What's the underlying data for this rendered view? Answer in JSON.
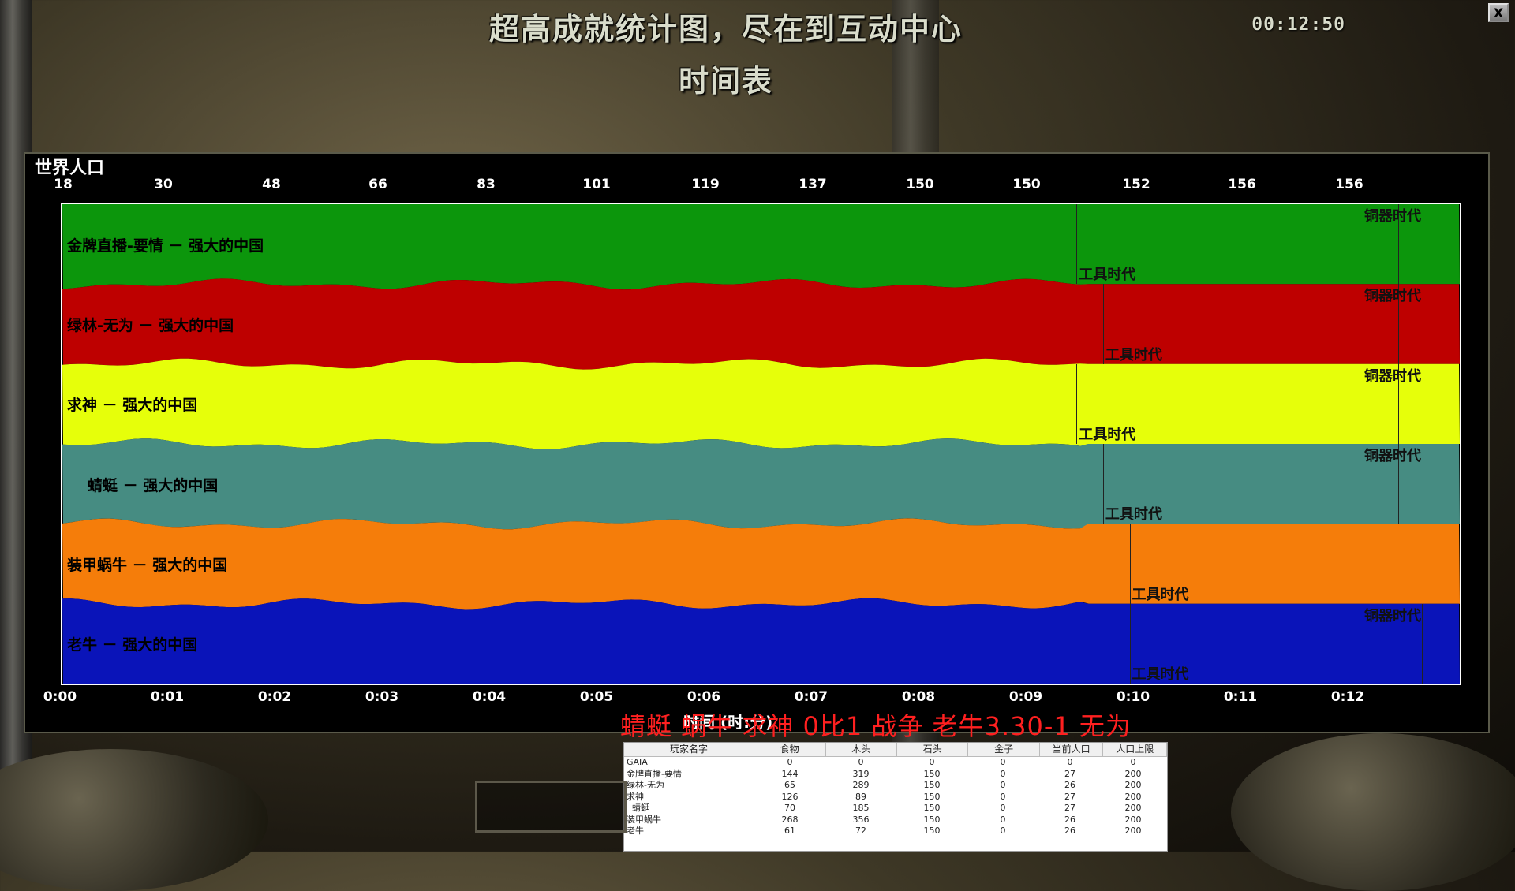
{
  "header": {
    "main_title": "超高成就统计图，尽在到互动中心",
    "sub_title": "时间表",
    "clock": "00:12:50",
    "close_label": "X"
  },
  "chart_data": {
    "type": "area",
    "label": "世界人口",
    "population_ticks": [
      "18",
      "30",
      "48",
      "66",
      "83",
      "101",
      "119",
      "137",
      "150",
      "150",
      "152",
      "156",
      "156"
    ],
    "time_ticks": [
      "0:00",
      "0:01",
      "0:02",
      "0:03",
      "0:04",
      "0:05",
      "0:06",
      "0:07",
      "0:08",
      "0:09",
      "0:10",
      "0:11",
      "0:12"
    ],
    "time_axis_label": "时间 (时:分)",
    "players": [
      {
        "name": "金牌直播-要情 － 强大的中国",
        "color": "#0c960c",
        "text_color": "#000000",
        "ages": [
          {
            "label": "工具时代",
            "time_min": 9.55
          },
          {
            "label": "铜器时代",
            "time_min": 12.58
          }
        ]
      },
      {
        "name": "绿林-无为 － 强大的中国",
        "color": "#be0000",
        "text_color": "#000000",
        "ages": [
          {
            "label": "工具时代",
            "time_min": 9.8
          },
          {
            "label": "铜器时代",
            "time_min": 12.58
          }
        ]
      },
      {
        "name": "求神 － 强大的中国",
        "color": "#e6ff0a",
        "text_color": "#000000",
        "ages": [
          {
            "label": "工具时代",
            "time_min": 9.55
          },
          {
            "label": "铜器时代",
            "time_min": 12.58
          }
        ]
      },
      {
        "name": "蜻蜓 － 强大的中国",
        "color": "#468c82",
        "text_color": "#000000",
        "ages": [
          {
            "label": "工具时代",
            "time_min": 9.8
          },
          {
            "label": "铜器时代",
            "time_min": 12.58
          }
        ]
      },
      {
        "name": "装甲蜗牛 － 强大的中国",
        "color": "#f57d0a",
        "text_color": "#000000",
        "ages": [
          {
            "label": "工具时代",
            "time_min": 10.05
          }
        ]
      },
      {
        "name": "老牛 － 强大的中国",
        "color": "#0a14b9",
        "text_color": "#000000",
        "ages": [
          {
            "label": "工具时代",
            "time_min": 10.05
          },
          {
            "label": "铜器时代",
            "time_min": 12.8
          }
        ]
      }
    ],
    "time_range_min": [
      0,
      13.1
    ]
  },
  "scoreline": "蜻蜓 蜗牛 求神   0比1  战争 老牛3.30-1 无为",
  "stats": {
    "headers": [
      "玩家名字",
      "食物",
      "木头",
      "石头",
      "金子",
      "当前人口",
      "人口上限"
    ],
    "rows": [
      [
        "GAIA",
        "0",
        "0",
        "0",
        "0",
        "0",
        "0"
      ],
      [
        "金牌直播-要情",
        "144",
        "319",
        "150",
        "0",
        "27",
        "200"
      ],
      [
        "绿林-无为",
        "65",
        "289",
        "150",
        "0",
        "26",
        "200"
      ],
      [
        "求神",
        "126",
        "89",
        "150",
        "0",
        "27",
        "200"
      ],
      [
        "  蜻蜓",
        "70",
        "185",
        "150",
        "0",
        "27",
        "200"
      ],
      [
        "装甲蜗牛",
        "268",
        "356",
        "150",
        "0",
        "26",
        "200"
      ],
      [
        "老牛",
        "61",
        "72",
        "150",
        "0",
        "26",
        "200"
      ]
    ]
  }
}
